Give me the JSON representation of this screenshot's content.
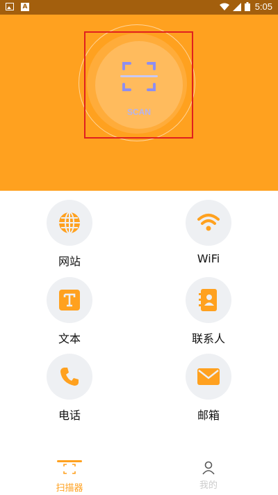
{
  "status_bar": {
    "time": "5:05"
  },
  "header": {
    "scan_label": "SCAN",
    "bg_color": "#ffa11f"
  },
  "grid": {
    "items": [
      {
        "label": "网站",
        "icon": "globe-icon"
      },
      {
        "label": "WiFi",
        "icon": "wifi-icon"
      },
      {
        "label": "文本",
        "icon": "text-icon"
      },
      {
        "label": "联系人",
        "icon": "contacts-icon"
      },
      {
        "label": "电话",
        "icon": "phone-icon"
      },
      {
        "label": "邮箱",
        "icon": "mail-icon"
      }
    ]
  },
  "bottom_nav": {
    "items": [
      {
        "label": "扫描器",
        "icon": "scanner-icon",
        "active": true
      },
      {
        "label": "我的",
        "icon": "person-icon",
        "active": false
      }
    ]
  },
  "colors": {
    "accent": "#ffa11f",
    "status_bar": "#a35f0d",
    "scan_icon": "#8e8ef0",
    "inactive": "#cccccc"
  }
}
